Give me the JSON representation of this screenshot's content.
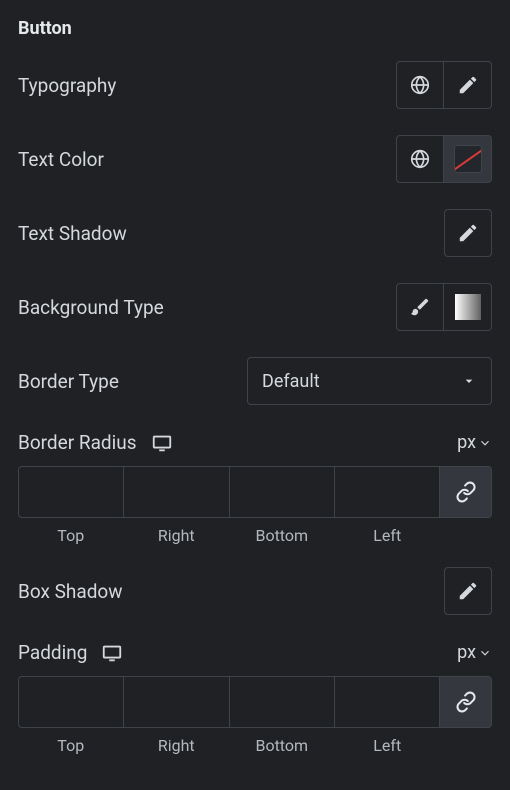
{
  "section_title": "Button",
  "typography": {
    "label": "Typography"
  },
  "text_color": {
    "label": "Text Color"
  },
  "text_shadow": {
    "label": "Text Shadow"
  },
  "background_type": {
    "label": "Background Type"
  },
  "border_type": {
    "label": "Border Type",
    "value": "Default"
  },
  "border_radius": {
    "label": "Border Radius",
    "unit": "px",
    "sides": {
      "top": "Top",
      "right": "Right",
      "bottom": "Bottom",
      "left": "Left"
    }
  },
  "box_shadow": {
    "label": "Box Shadow"
  },
  "padding": {
    "label": "Padding",
    "unit": "px",
    "sides": {
      "top": "Top",
      "right": "Right",
      "bottom": "Bottom",
      "left": "Left"
    }
  }
}
